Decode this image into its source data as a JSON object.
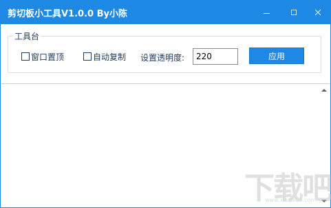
{
  "window": {
    "title": "剪切板小工具V1.0.0  By小陈",
    "accent": "#1e88e5"
  },
  "toolbox": {
    "legend": "工具台",
    "topmost": {
      "label": "窗口置顶",
      "checked": false
    },
    "autocopy": {
      "label": "自动复制",
      "checked": false
    },
    "opacity_label": "设置透明度:",
    "opacity_value": "220",
    "apply_label": "应用"
  },
  "clipboard_text": "",
  "watermark": {
    "text": "下载吧",
    "url": "www.xiazaiba.com"
  },
  "icons": [
    "minimize-icon",
    "maximize-icon",
    "close-icon",
    "scroll-up-arrow-icon",
    "scroll-down-arrow-icon"
  ]
}
